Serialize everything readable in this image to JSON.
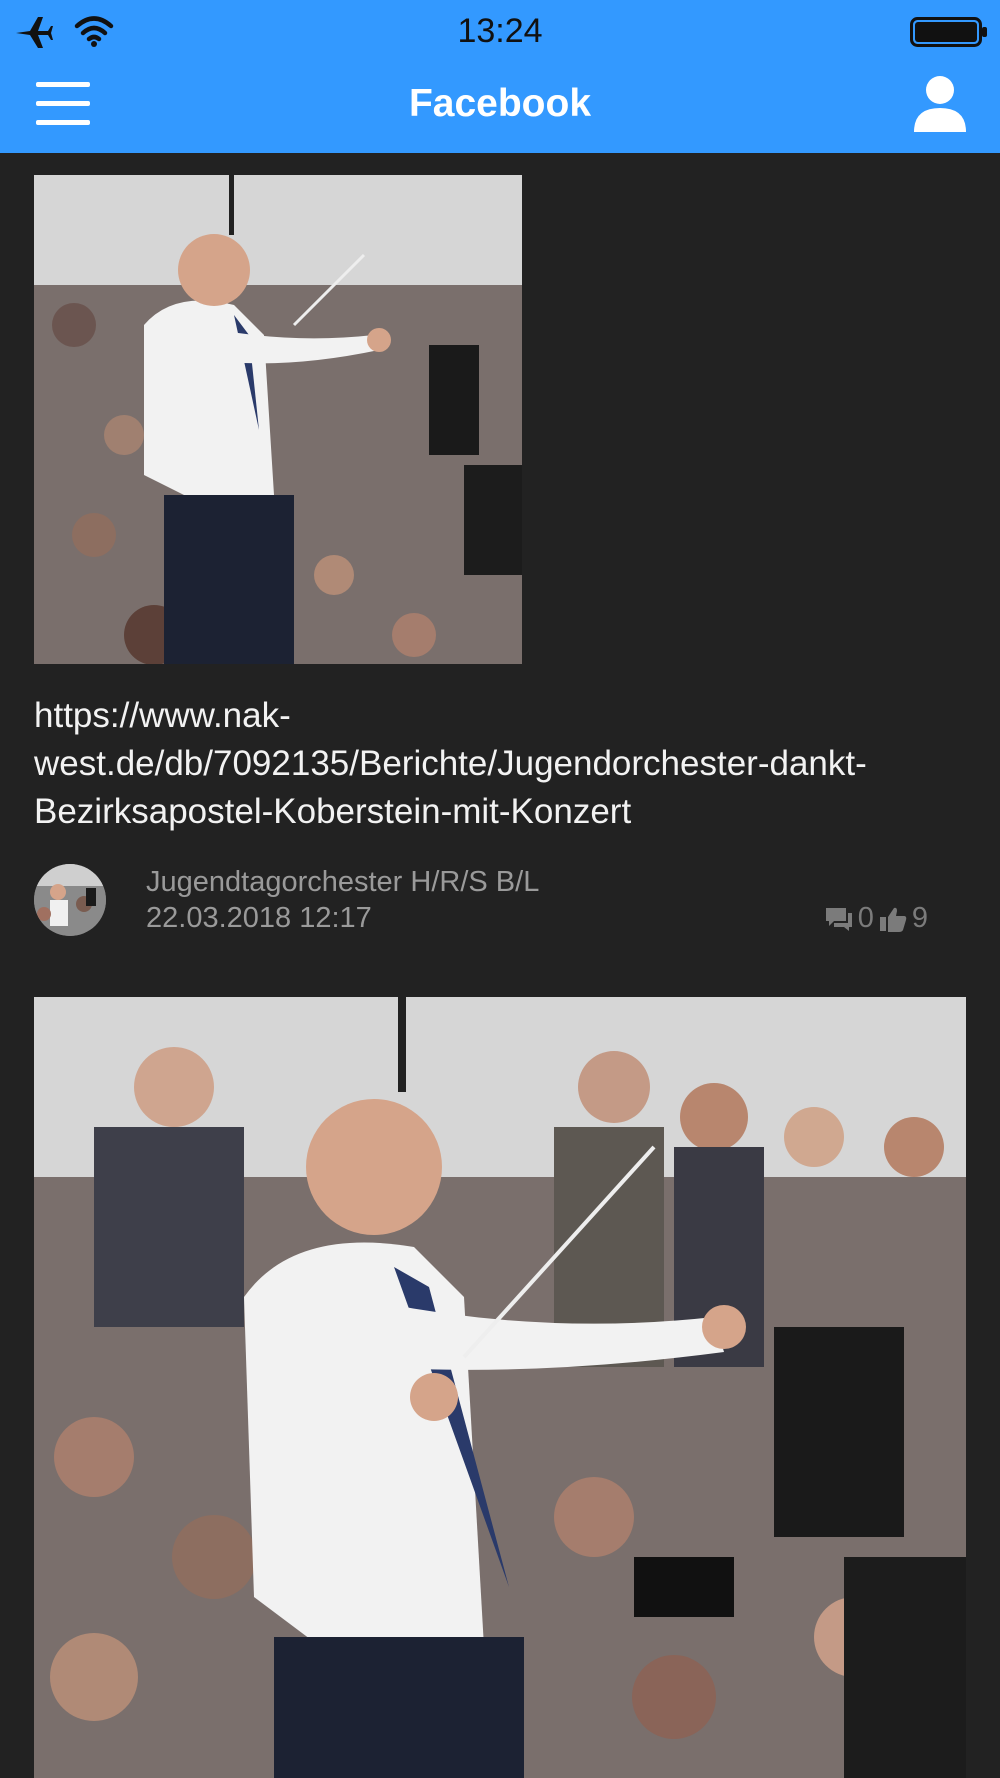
{
  "status_bar": {
    "time": "13:24"
  },
  "header": {
    "title": "Facebook"
  },
  "icons": {
    "menu": "hamburger-menu-icon",
    "user": "user-profile-icon",
    "comments": "comment-icon",
    "likes": "thumbs-up-icon"
  },
  "colors": {
    "header_bg": "#3399ff",
    "page_bg": "#222222",
    "meta_text": "#9a9a9a"
  },
  "posts": [
    {
      "link": "https://www.nak-west.de/db/7092135/Berichte/Jugendorchester-dankt-Bezirksapostel-Koberstein-mit-Konzert",
      "author": "Jugendtagorchester H/R/S B/L",
      "date": "22.03.2018 12:17",
      "comments": "0",
      "likes": "9"
    }
  ]
}
